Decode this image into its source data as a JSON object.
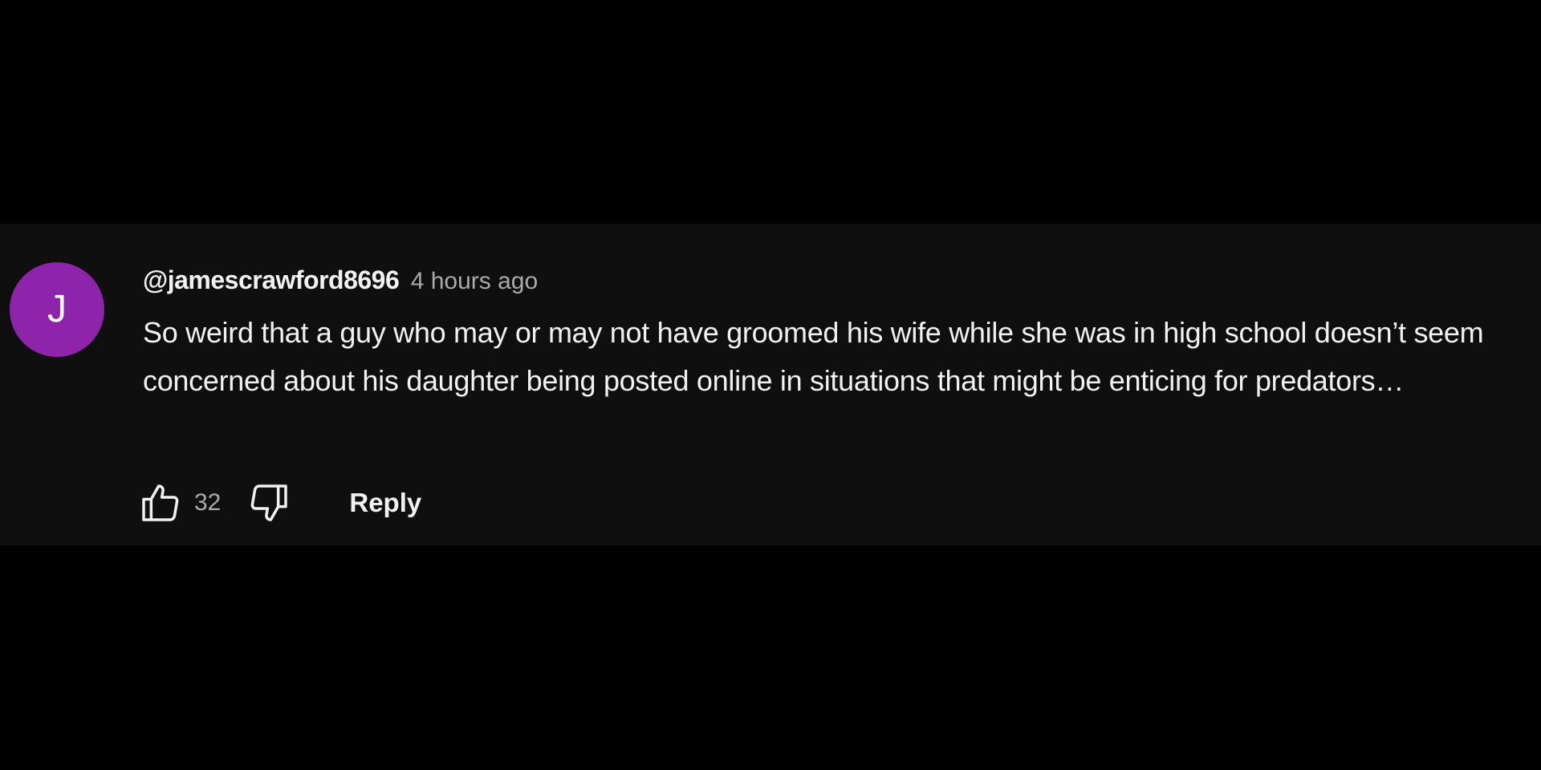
{
  "comment": {
    "avatar_letter": "J",
    "avatar_color": "#8e24aa",
    "author": "@jamescrawford8696",
    "timestamp": "4 hours ago",
    "text": "So weird that a guy who may or may not have groomed his wife while she was in high school doesn’t seem concerned about his daughter being posted online in situations that might be enticing for predators…",
    "like_count": "32",
    "reply_label": "Reply"
  },
  "icons": {
    "like": "thumbs-up-icon",
    "dislike": "thumbs-down-icon"
  }
}
